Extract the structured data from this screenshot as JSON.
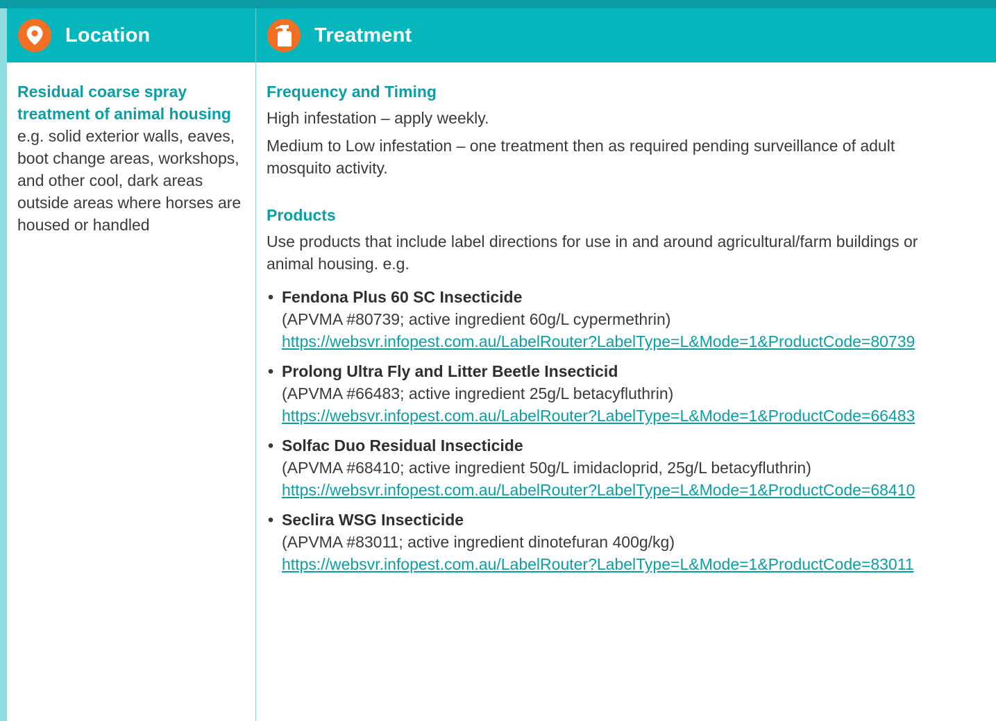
{
  "header": {
    "location_title": "Location",
    "treatment_title": "Treatment",
    "location_icon": "map-pin-icon",
    "treatment_icon": "spray-bottle-icon",
    "accent_color": "#05b6bc",
    "icon_color": "#f26f23"
  },
  "location": {
    "heading": "Residual coarse spray treatment of animal housing",
    "description": "e.g. solid exterior walls, eaves, boot change areas, workshops, and other cool, dark areas outside areas where horses are housed or handled"
  },
  "treatment": {
    "frequency_heading": "Frequency and Timing",
    "frequency_high": "High infestation – apply weekly.",
    "frequency_low": "Medium to Low infestation – one treatment then as required pending surveillance of adult mosquito activity.",
    "products_heading": "Products",
    "products_intro": "Use products that include label directions for use in and around agricultural/farm buildings or animal housing. e.g.",
    "products": [
      {
        "name": "Fendona Plus 60 SC Insecticide",
        "details": "(APVMA #80739; active ingredient 60g/L cypermethrin)",
        "link": "https://websvr.infopest.com.au/LabelRouter?LabelType=L&Mode=1&ProductCode=80739"
      },
      {
        "name": "Prolong Ultra Fly and Litter Beetle Insecticid",
        "details": "(APVMA #66483; active ingredient 25g/L betacyfluthrin)",
        "link": "https://websvr.infopest.com.au/LabelRouter?LabelType=L&Mode=1&ProductCode=66483"
      },
      {
        "name": "Solfac Duo Residual Insecticide",
        "details": "(APVMA #68410; active ingredient 50g/L imidacloprid, 25g/L betacyfluthrin)",
        "link": "https://websvr.infopest.com.au/LabelRouter?LabelType=L&Mode=1&ProductCode=68410"
      },
      {
        "name": "Seclira WSG Insecticide",
        "details": "(APVMA #83011; active ingredient dinotefuran 400g/kg)",
        "link": "https://websvr.infopest.com.au/LabelRouter?LabelType=L&Mode=1&ProductCode=83011"
      }
    ]
  }
}
